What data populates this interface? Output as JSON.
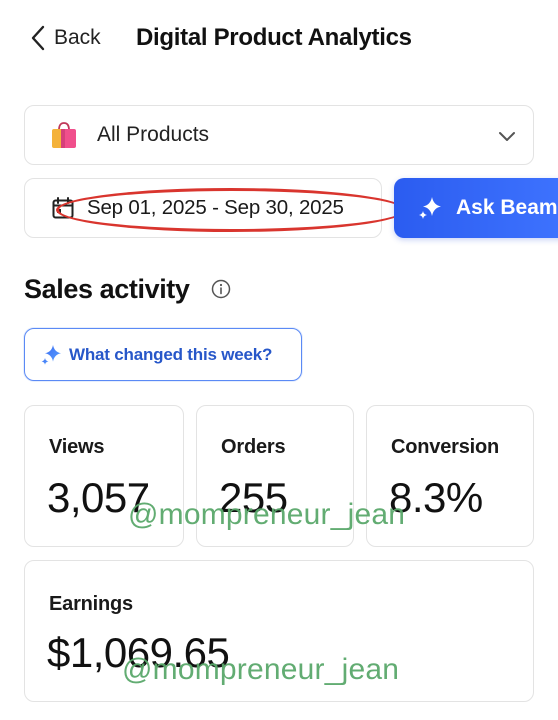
{
  "header": {
    "back_label": "Back",
    "title": "Digital Product Analytics"
  },
  "filters": {
    "product_select": "All Products",
    "date_range": "Sep 01, 2025 - Sep 30, 2025",
    "ask_button": "Ask Beam"
  },
  "sales": {
    "section_title": "Sales activity",
    "what_changed": "What changed this week?",
    "metrics": [
      {
        "label": "Views",
        "value": "3,057"
      },
      {
        "label": "Orders",
        "value": "255"
      },
      {
        "label": "Conversion",
        "value": "8.3%"
      }
    ],
    "earnings": {
      "label": "Earnings",
      "value": "$1,069.65"
    }
  },
  "watermark": "@mompreneur_jean",
  "colors": {
    "accent": "#2b5cf0",
    "highlight_oval": "#d9352e",
    "watermark": "#5aa86b"
  },
  "icons": [
    "chevron-left-icon",
    "shopping-bag-icon",
    "chevron-down-icon",
    "calendar-icon",
    "sparkle-icon",
    "info-icon"
  ]
}
